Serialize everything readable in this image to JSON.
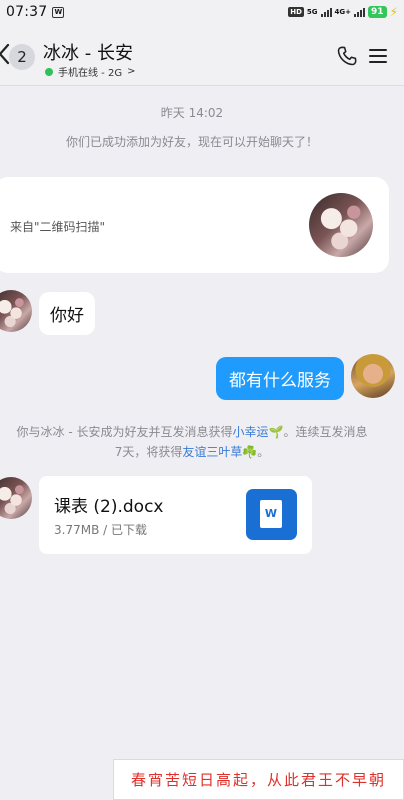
{
  "status_bar": {
    "time": "07:37",
    "sim_label": "W",
    "hd": "HD",
    "net1": "5G",
    "net2": "4G+",
    "battery": "91"
  },
  "header": {
    "unread_count": "2",
    "contact_name": "冰冰 - 长安",
    "status_text": "手机在线 - 2G",
    "status_chevron": ">",
    "online_color": "#2dc25a"
  },
  "chat": {
    "timestamp": "昨天 14:02",
    "added_notice": "你们已成功添加为好友，现在可以开始聊天了！",
    "qr_card_text": "来自\"二维码扫描\"",
    "messages": [
      {
        "side": "in",
        "text": "你好"
      },
      {
        "side": "out",
        "text": "都有什么服务"
      }
    ],
    "system_note": {
      "part1": "你与冰冰 - 长安成为好友并互发消息获得",
      "link1": "小幸运🌱",
      "part2": "。连续互发消息",
      "part3": "7天，将获得",
      "link2": "友谊三叶草☘️",
      "part4": "。"
    },
    "file": {
      "name": "课表 (2).docx",
      "meta": "3.77MB / 已下载",
      "icon_letter": "W"
    }
  },
  "watermark": {
    "text": "春宵苦短日高起，从此君王不早朝"
  },
  "colors": {
    "outgoing_bubble": "#1e9bfc",
    "link": "#3a7bd5",
    "background": "#eeeef3"
  }
}
